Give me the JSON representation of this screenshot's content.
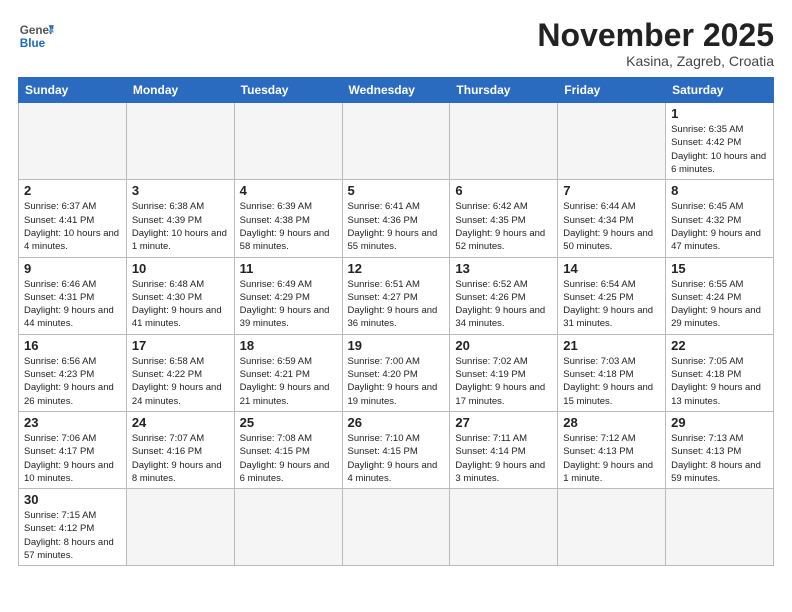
{
  "header": {
    "logo_general": "General",
    "logo_blue": "Blue",
    "month_title": "November 2025",
    "subtitle": "Kasina, Zagreb, Croatia"
  },
  "weekdays": [
    "Sunday",
    "Monday",
    "Tuesday",
    "Wednesday",
    "Thursday",
    "Friday",
    "Saturday"
  ],
  "weeks": [
    [
      {
        "day": "",
        "info": "",
        "empty": true
      },
      {
        "day": "",
        "info": "",
        "empty": true
      },
      {
        "day": "",
        "info": "",
        "empty": true
      },
      {
        "day": "",
        "info": "",
        "empty": true
      },
      {
        "day": "",
        "info": "",
        "empty": true
      },
      {
        "day": "",
        "info": "",
        "empty": true
      },
      {
        "day": "1",
        "info": "Sunrise: 6:35 AM\nSunset: 4:42 PM\nDaylight: 10 hours\nand 6 minutes."
      }
    ],
    [
      {
        "day": "2",
        "info": "Sunrise: 6:37 AM\nSunset: 4:41 PM\nDaylight: 10 hours\nand 4 minutes."
      },
      {
        "day": "3",
        "info": "Sunrise: 6:38 AM\nSunset: 4:39 PM\nDaylight: 10 hours\nand 1 minute."
      },
      {
        "day": "4",
        "info": "Sunrise: 6:39 AM\nSunset: 4:38 PM\nDaylight: 9 hours\nand 58 minutes."
      },
      {
        "day": "5",
        "info": "Sunrise: 6:41 AM\nSunset: 4:36 PM\nDaylight: 9 hours\nand 55 minutes."
      },
      {
        "day": "6",
        "info": "Sunrise: 6:42 AM\nSunset: 4:35 PM\nDaylight: 9 hours\nand 52 minutes."
      },
      {
        "day": "7",
        "info": "Sunrise: 6:44 AM\nSunset: 4:34 PM\nDaylight: 9 hours\nand 50 minutes."
      },
      {
        "day": "8",
        "info": "Sunrise: 6:45 AM\nSunset: 4:32 PM\nDaylight: 9 hours\nand 47 minutes."
      }
    ],
    [
      {
        "day": "9",
        "info": "Sunrise: 6:46 AM\nSunset: 4:31 PM\nDaylight: 9 hours\nand 44 minutes."
      },
      {
        "day": "10",
        "info": "Sunrise: 6:48 AM\nSunset: 4:30 PM\nDaylight: 9 hours\nand 41 minutes."
      },
      {
        "day": "11",
        "info": "Sunrise: 6:49 AM\nSunset: 4:29 PM\nDaylight: 9 hours\nand 39 minutes."
      },
      {
        "day": "12",
        "info": "Sunrise: 6:51 AM\nSunset: 4:27 PM\nDaylight: 9 hours\nand 36 minutes."
      },
      {
        "day": "13",
        "info": "Sunrise: 6:52 AM\nSunset: 4:26 PM\nDaylight: 9 hours\nand 34 minutes."
      },
      {
        "day": "14",
        "info": "Sunrise: 6:54 AM\nSunset: 4:25 PM\nDaylight: 9 hours\nand 31 minutes."
      },
      {
        "day": "15",
        "info": "Sunrise: 6:55 AM\nSunset: 4:24 PM\nDaylight: 9 hours\nand 29 minutes."
      }
    ],
    [
      {
        "day": "16",
        "info": "Sunrise: 6:56 AM\nSunset: 4:23 PM\nDaylight: 9 hours\nand 26 minutes."
      },
      {
        "day": "17",
        "info": "Sunrise: 6:58 AM\nSunset: 4:22 PM\nDaylight: 9 hours\nand 24 minutes."
      },
      {
        "day": "18",
        "info": "Sunrise: 6:59 AM\nSunset: 4:21 PM\nDaylight: 9 hours\nand 21 minutes."
      },
      {
        "day": "19",
        "info": "Sunrise: 7:00 AM\nSunset: 4:20 PM\nDaylight: 9 hours\nand 19 minutes."
      },
      {
        "day": "20",
        "info": "Sunrise: 7:02 AM\nSunset: 4:19 PM\nDaylight: 9 hours\nand 17 minutes."
      },
      {
        "day": "21",
        "info": "Sunrise: 7:03 AM\nSunset: 4:18 PM\nDaylight: 9 hours\nand 15 minutes."
      },
      {
        "day": "22",
        "info": "Sunrise: 7:05 AM\nSunset: 4:18 PM\nDaylight: 9 hours\nand 13 minutes."
      }
    ],
    [
      {
        "day": "23",
        "info": "Sunrise: 7:06 AM\nSunset: 4:17 PM\nDaylight: 9 hours\nand 10 minutes."
      },
      {
        "day": "24",
        "info": "Sunrise: 7:07 AM\nSunset: 4:16 PM\nDaylight: 9 hours\nand 8 minutes."
      },
      {
        "day": "25",
        "info": "Sunrise: 7:08 AM\nSunset: 4:15 PM\nDaylight: 9 hours\nand 6 minutes."
      },
      {
        "day": "26",
        "info": "Sunrise: 7:10 AM\nSunset: 4:15 PM\nDaylight: 9 hours\nand 4 minutes."
      },
      {
        "day": "27",
        "info": "Sunrise: 7:11 AM\nSunset: 4:14 PM\nDaylight: 9 hours\nand 3 minutes."
      },
      {
        "day": "28",
        "info": "Sunrise: 7:12 AM\nSunset: 4:13 PM\nDaylight: 9 hours\nand 1 minute."
      },
      {
        "day": "29",
        "info": "Sunrise: 7:13 AM\nSunset: 4:13 PM\nDaylight: 8 hours\nand 59 minutes."
      }
    ],
    [
      {
        "day": "30",
        "info": "Sunrise: 7:15 AM\nSunset: 4:12 PM\nDaylight: 8 hours\nand 57 minutes."
      },
      {
        "day": "",
        "info": "",
        "empty": true
      },
      {
        "day": "",
        "info": "",
        "empty": true
      },
      {
        "day": "",
        "info": "",
        "empty": true
      },
      {
        "day": "",
        "info": "",
        "empty": true
      },
      {
        "day": "",
        "info": "",
        "empty": true
      },
      {
        "day": "",
        "info": "",
        "empty": true
      }
    ]
  ]
}
